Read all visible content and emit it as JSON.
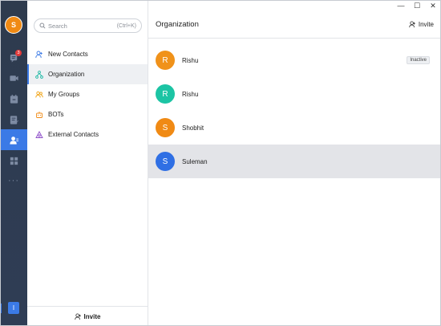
{
  "window": {
    "minimize": "—",
    "maximize": "☐",
    "close": "✕"
  },
  "rail": {
    "avatar_initial": "S",
    "chat_badge": "3",
    "more": "···",
    "bottom_label": "I"
  },
  "search": {
    "placeholder": "Search",
    "shortcut": "(Ctrl+K)"
  },
  "menu": [
    {
      "label": "New Contacts",
      "icon": "add-user-icon",
      "color": "#3b7ae6"
    },
    {
      "label": "Organization",
      "icon": "org-tree-icon",
      "color": "#1cb8a3"
    },
    {
      "label": "My Groups",
      "icon": "group-icon",
      "color": "#f0a314"
    },
    {
      "label": "BOTs",
      "icon": "bot-icon",
      "color": "#f08a14"
    },
    {
      "label": "External Contacts",
      "icon": "external-icon",
      "color": "#8e4fc9"
    }
  ],
  "invite_bottom": "Invite",
  "main": {
    "title": "Organization",
    "invite": "Invite",
    "contacts": [
      {
        "initial": "R",
        "name": "Rishu",
        "color": "#f0921a",
        "badge": "Inactive"
      },
      {
        "initial": "R",
        "name": "Rishu",
        "color": "#1cc4a4"
      },
      {
        "initial": "S",
        "name": "Shobhit",
        "color": "#f08a14"
      },
      {
        "initial": "S",
        "name": "Suleman",
        "color": "#2f6fe4",
        "selected": true
      }
    ]
  }
}
